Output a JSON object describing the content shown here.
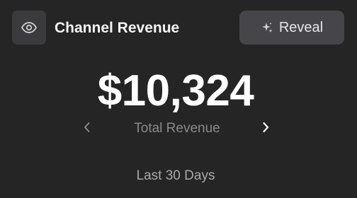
{
  "header": {
    "title": "Channel Revenue",
    "eye_icon": "eye-icon",
    "reveal_label": "Reveal",
    "reveal_icon": "sparkles-icon"
  },
  "metric": {
    "value": "$10,324",
    "label": "Total Revenue",
    "prev_icon": "chevron-left-icon",
    "next_icon": "chevron-right-icon"
  },
  "footer": {
    "period": "Last 30 Days"
  },
  "colors": {
    "background": "#252525",
    "button_background": "#46464a",
    "primary_text": "#ffffff",
    "muted_text": "#8a8a8c"
  }
}
